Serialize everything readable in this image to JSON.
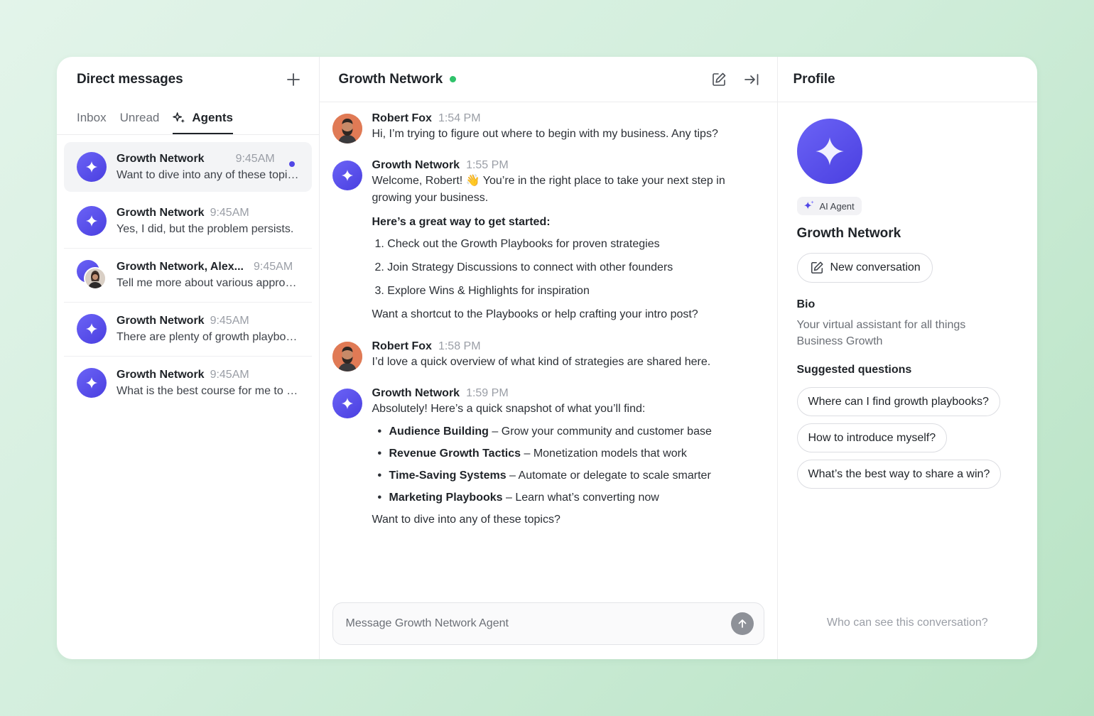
{
  "left": {
    "title": "Direct messages",
    "tabs": [
      {
        "label": "Inbox"
      },
      {
        "label": "Unread"
      },
      {
        "label": "Agents"
      }
    ],
    "conversations": [
      {
        "name": "Growth Network",
        "time": "9:45AM",
        "preview": "Want to dive into any of these topics?",
        "unread": true,
        "selected": true
      },
      {
        "name": "Growth Network",
        "time": "9:45AM",
        "preview": "Yes, I did, but the problem persists."
      },
      {
        "name": "Growth Network, Alex...",
        "time": "9:45AM",
        "preview": "Tell me more about various approaches"
      },
      {
        "name": "Growth Network",
        "time": "9:45AM",
        "preview": "There are plenty of growth playbooks"
      },
      {
        "name": "Growth Network",
        "time": "9:45AM",
        "preview": "What is the best course for me to take"
      }
    ]
  },
  "chat": {
    "title": "Growth Network",
    "messages": [
      {
        "author": "Robert Fox",
        "time": "1:54 PM",
        "text": "Hi, I’m trying to figure out where to begin with my business. Any tips?"
      },
      {
        "author": "Growth Network",
        "time": "1:55 PM",
        "text": "Welcome, Robert! 👋 You’re in the right place to take your next step in growing your business.",
        "heading": "Here’s a great way to get started:",
        "list": [
          "1. Check out the Growth Playbooks for proven strategies",
          "2. Join Strategy Discussions to connect with other founders",
          "3. Explore Wins & Highlights for inspiration"
        ],
        "closing": "Want a shortcut to the Playbooks or help crafting your intro post?"
      },
      {
        "author": "Robert Fox",
        "time": "1:58 PM",
        "text": "I’d love a quick overview of what kind of strategies are shared here."
      },
      {
        "author": "Growth Network",
        "time": "1:59 PM",
        "text": "Absolutely! Here’s a quick snapshot of what you’ll find:",
        "bullets": [
          {
            "bold": "Audience Building",
            "rest": " – Grow your community and customer base"
          },
          {
            "bold": "Revenue Growth Tactics",
            "rest": " – Monetization models that work"
          },
          {
            "bold": "Time-Saving Systems",
            "rest": " – Automate or delegate to scale smarter"
          },
          {
            "bold": "Marketing Playbooks",
            "rest": " – Learn what’s converting now"
          }
        ],
        "closing": "Want to dive into any of these topics?"
      }
    ],
    "composer": {
      "placeholder": "Message Growth Network Agent"
    }
  },
  "profile": {
    "title": "Profile",
    "badge": "AI Agent",
    "name": "Growth Network",
    "new_conversation": "New conversation",
    "bio_title": "Bio",
    "bio": "Your virtual assistant for all things Business Growth",
    "suggested_title": "Suggested questions",
    "suggested": [
      "Where can I find growth playbooks?",
      "How to introduce myself?",
      "What’s the best way to share a win?"
    ],
    "visibility_link": "Who can see this conversation?"
  },
  "colors": {
    "accent": "#5147e6",
    "online": "#2fc26a",
    "person_avatar": "#e07a55"
  }
}
